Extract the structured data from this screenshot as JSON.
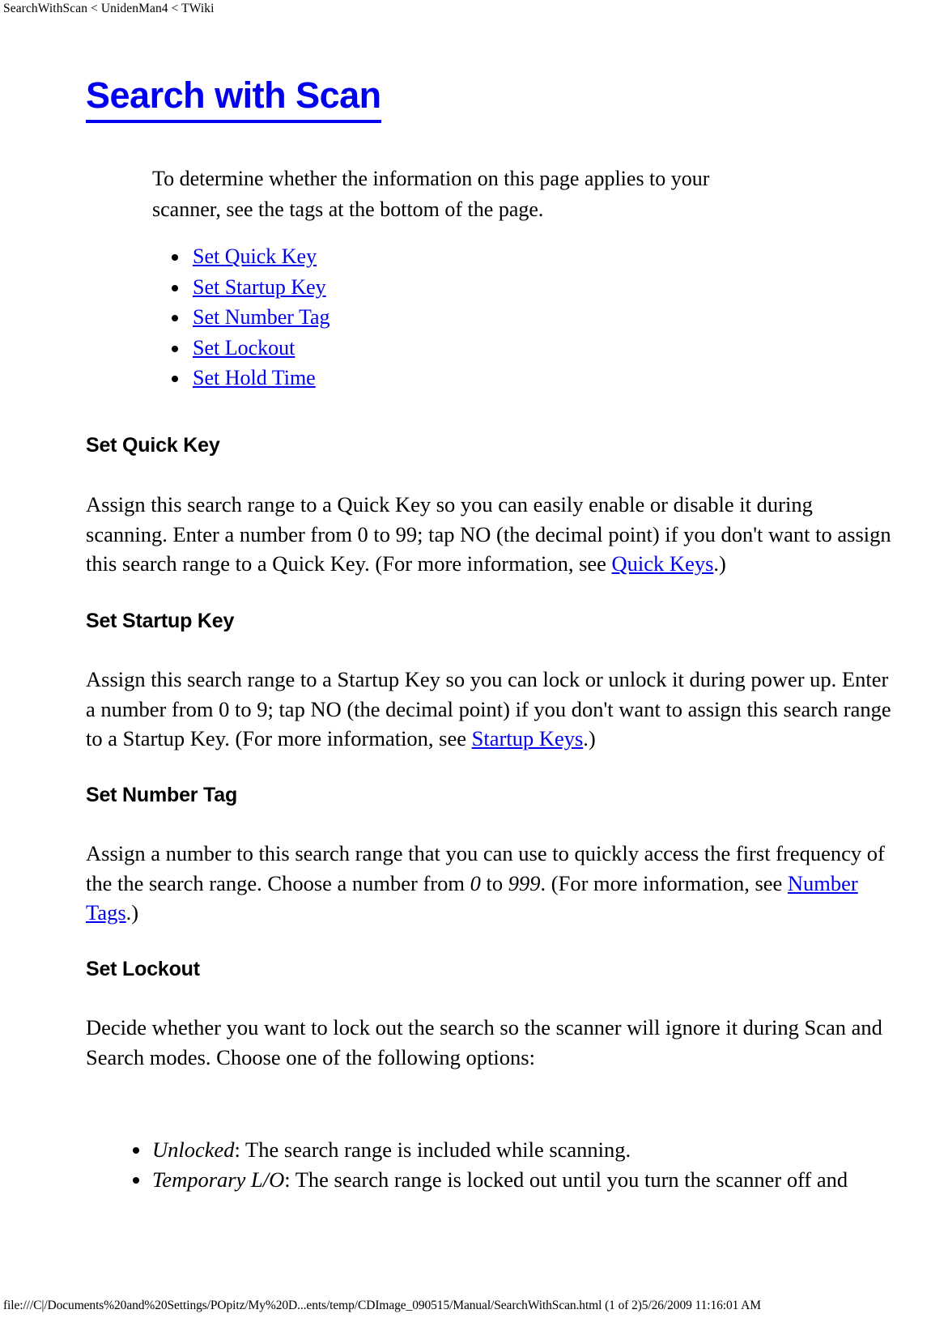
{
  "header": {
    "running_head": "SearchWithScan < UnidenMan4 < TWiki"
  },
  "title": "Search with Scan",
  "intro": "To determine whether the information on this page applies to your scanner, see the tags at the bottom of the page.",
  "toc": [
    {
      "label": "Set Quick Key"
    },
    {
      "label": "Set Startup Key"
    },
    {
      "label": "Set Number Tag"
    },
    {
      "label": "Set Lockout"
    },
    {
      "label": "Set Hold Time"
    }
  ],
  "sections": [
    {
      "heading": "Set Quick Key",
      "body_before_link": "Assign this search range to a Quick Key so you can easily enable or disable it during scanning. Enter a number from 0 to 99; tap NO (the decimal point) if you don't want to assign this search range to a Quick Key. (For more information, see ",
      "link": "Quick Keys",
      "body_after_link": ".)"
    },
    {
      "heading": "Set Startup Key",
      "body_before_link": "Assign this search range to a Startup Key so you can lock or unlock it during power up. Enter a number from 0 to 9; tap NO (the decimal point) if you don't want to assign this search range to a Startup Key. (For more information, see ",
      "link": "Startup Keys",
      "body_after_link": ".)"
    },
    {
      "heading": "Set Number Tag",
      "body_part1": "Assign a number to this search range that you can use to quickly access the first frequency of the the search range. Choose a number from ",
      "italic1": "0",
      "body_part2": " to ",
      "italic2": "999",
      "body_part3": ". (For more information, see ",
      "link": "Number Tags",
      "body_after_link": ".)"
    },
    {
      "heading": "Set Lockout",
      "body": "Decide whether you want to lock out the search so the scanner will ignore it during Scan and Search modes. Choose one of the following options:",
      "options": [
        {
          "term": "Unlocked",
          "desc": ": The search range is included while scanning."
        },
        {
          "term": "Temporary L/O",
          "desc": ": The search range is locked out until you turn the scanner off and"
        }
      ]
    }
  ],
  "footer": {
    "text": "file:///C|/Documents%20and%20Settings/POpitz/My%20D...ents/temp/CDImage_090515/Manual/SearchWithScan.html (1 of 2)5/26/2009 11:16:01 AM"
  },
  "colors": {
    "link": "#0000EE",
    "text": "#000000",
    "background": "#FFFFFF"
  }
}
